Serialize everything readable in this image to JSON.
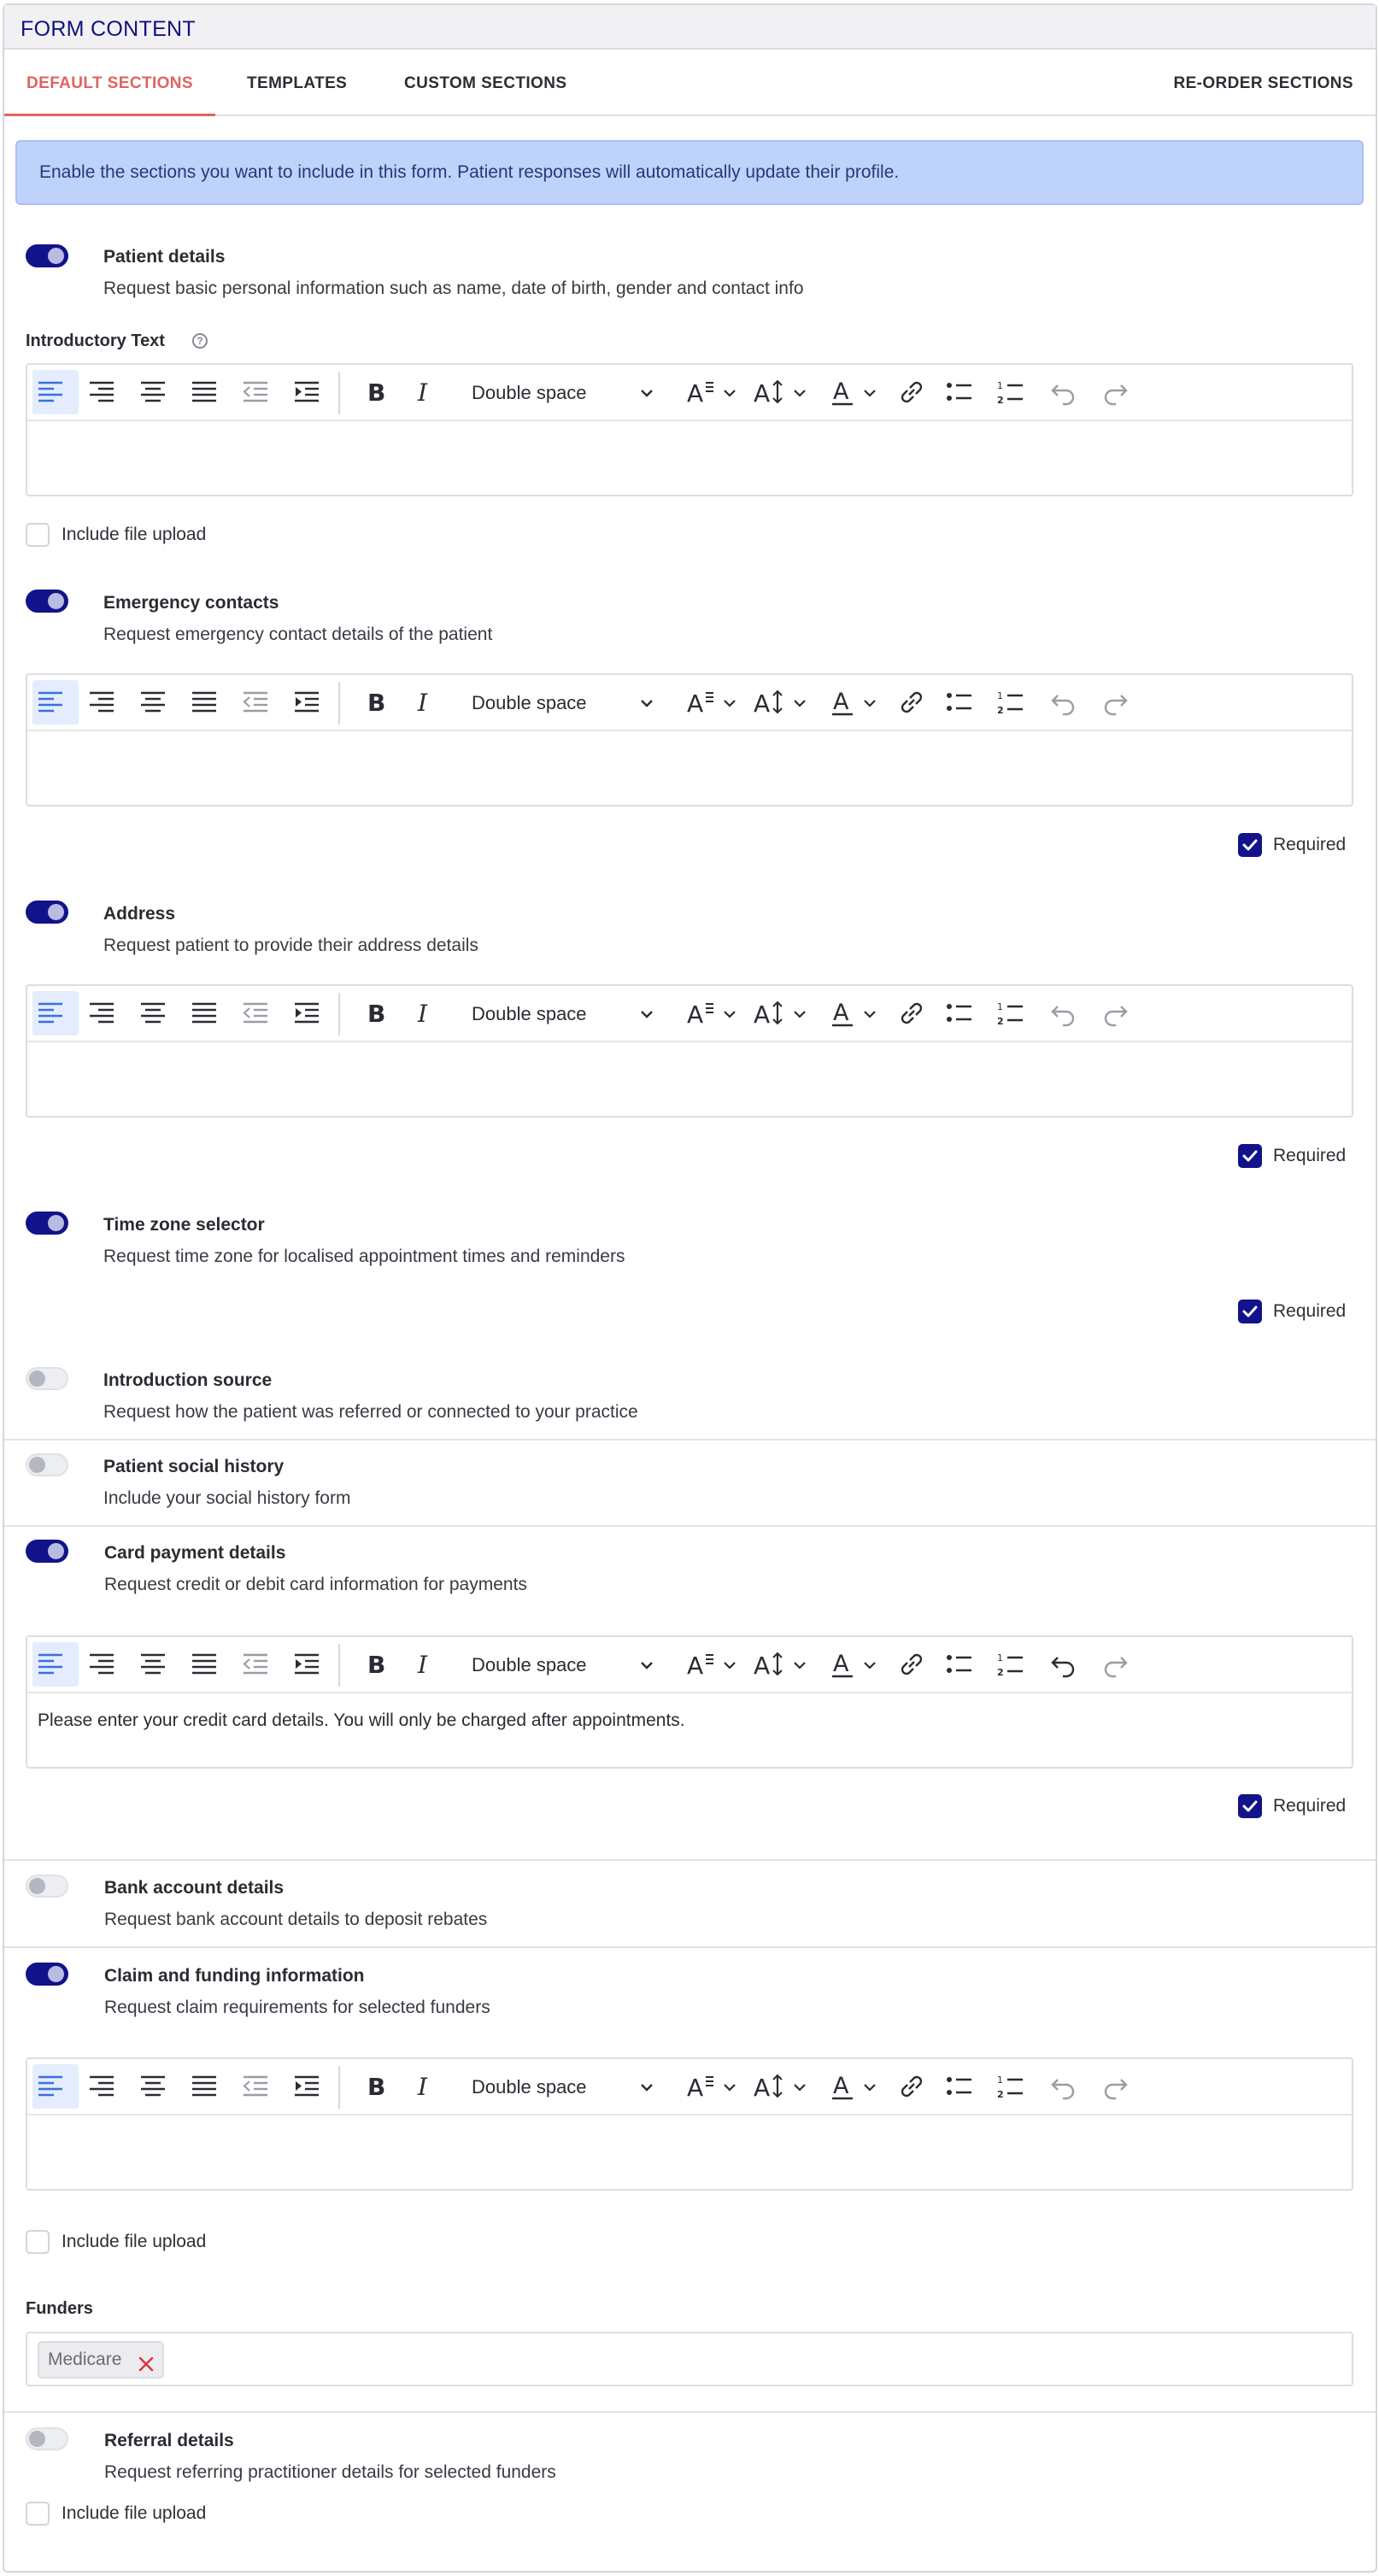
{
  "header": {
    "title": "FORM CONTENT"
  },
  "tabs": [
    {
      "label": "DEFAULT SECTIONS",
      "active": true
    },
    {
      "label": "TEMPLATES",
      "active": false
    },
    {
      "label": "CUSTOM SECTIONS",
      "active": false
    }
  ],
  "reorder_label": "RE-ORDER SECTIONS",
  "banner": "Enable the sections you want to include in this form. Patient responses will automatically update their profile.",
  "editor": {
    "spacing_value": "Double space"
  },
  "labels": {
    "introductory_text": "Introductory Text",
    "include_file_upload": "Include file upload",
    "required": "Required",
    "funders": "Funders"
  },
  "sections": [
    {
      "title": "Patient details",
      "desc": "Request basic personal information such as name, date of birth, gender and contact info",
      "enabled": true
    },
    {
      "title": "Emergency contacts",
      "desc": "Request emergency contact details of the patient",
      "enabled": true,
      "required": true
    },
    {
      "title": "Address",
      "desc": "Request patient to provide their address details",
      "enabled": true,
      "required": true
    },
    {
      "title": "Time zone selector",
      "desc": "Request time zone for localised appointment times and reminders",
      "enabled": true,
      "required": true
    },
    {
      "title": "Introduction source",
      "desc": "Request how the patient was referred or connected to your practice",
      "enabled": false
    },
    {
      "title": "Patient social history",
      "desc": "Include your social history form",
      "enabled": false
    },
    {
      "title": "Card payment details",
      "desc": "Request credit or debit card information for payments",
      "enabled": true,
      "required": true,
      "editor_text": "Please enter your credit card details. You will only be charged after appointments."
    },
    {
      "title": "Bank account details",
      "desc": "Request bank account details to deposit rebates",
      "enabled": false
    },
    {
      "title": "Claim and funding information",
      "desc": "Request claim requirements for selected funders",
      "enabled": true
    },
    {
      "title": "Referral details",
      "desc": "Request referring practitioner details for selected funders",
      "enabled": false
    }
  ],
  "funders": [
    "Medicare"
  ],
  "colors": {
    "accent": "#12128a",
    "tab_active": "#e0645e",
    "banner_bg": "#bfd2fa",
    "tag_close": "#d9363e"
  }
}
